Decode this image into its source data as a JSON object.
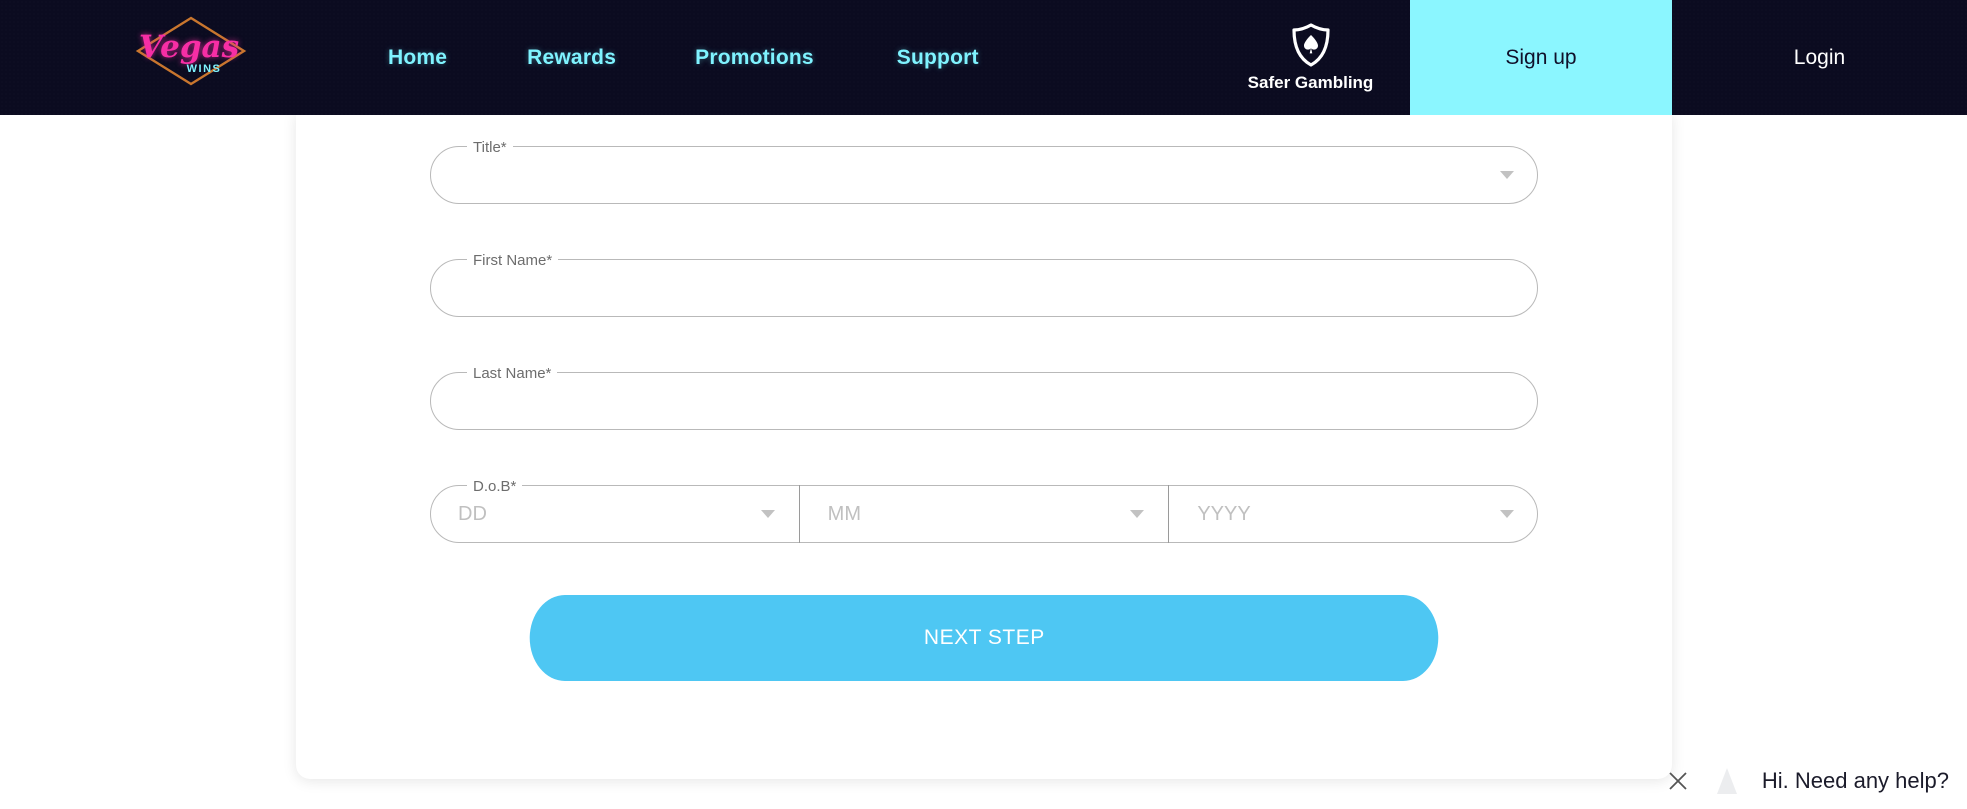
{
  "header": {
    "logo": {
      "name": "vegas-wins-logo",
      "script_text": "Vegas",
      "sub_text": "WINS",
      "script_color": "#f72ea5",
      "sub_color": "#7ff3ff",
      "frame_color": "#c9762e"
    },
    "nav": [
      {
        "label": "Home",
        "name": "nav-link-home"
      },
      {
        "label": "Rewards",
        "name": "nav-link-rewards"
      },
      {
        "label": "Promotions",
        "name": "nav-link-promotions"
      },
      {
        "label": "Support",
        "name": "nav-link-support"
      }
    ],
    "safer_gambling": {
      "label": "Safer Gambling",
      "icon": "shield-spade-icon"
    },
    "signup_label": "Sign up",
    "login_label": "Login",
    "background_color": "#0b0b20",
    "nav_link_color": "#7ff3ff",
    "signup_bg_color": "#8bf6ff"
  },
  "form": {
    "fields": [
      {
        "label": "Title*",
        "value": "",
        "placeholder": "",
        "type": "select",
        "name": "title-select"
      },
      {
        "label": "First Name*",
        "value": "",
        "placeholder": "",
        "type": "text",
        "name": "first-name-input"
      },
      {
        "label": "Last Name*",
        "value": "",
        "placeholder": "",
        "type": "text",
        "name": "last-name-input"
      }
    ],
    "dob": {
      "label": "D.o.B*",
      "segments": [
        {
          "placeholder": "DD",
          "value": "",
          "name": "dob-day-select"
        },
        {
          "placeholder": "MM",
          "value": "",
          "name": "dob-month-select"
        },
        {
          "placeholder": "YYYY",
          "value": "",
          "name": "dob-year-select"
        }
      ]
    },
    "submit_label": "NEXT STEP",
    "submit_color": "#4ec7f3"
  },
  "chat": {
    "message": "Hi. Need any help?",
    "close_icon": "close-icon",
    "avatar_icon": "chat-avatar-icon"
  }
}
